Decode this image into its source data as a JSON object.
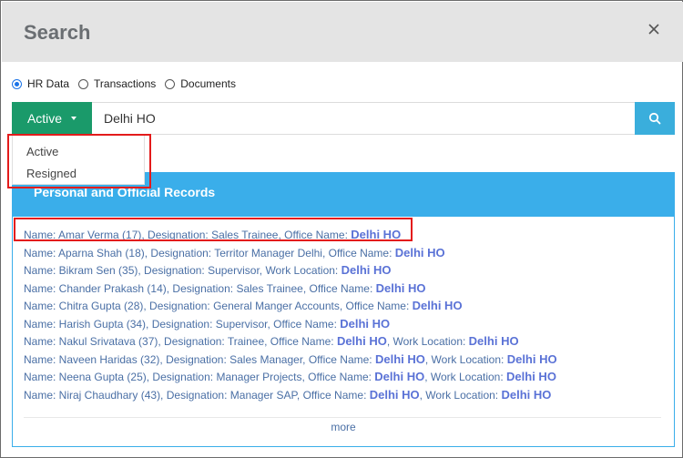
{
  "modal": {
    "title": "Search"
  },
  "search_type": {
    "options": [
      {
        "label": "HR Data",
        "checked": true
      },
      {
        "label": "Transactions",
        "checked": false
      },
      {
        "label": "Documents",
        "checked": false
      }
    ]
  },
  "search_bar": {
    "status_label": "Active",
    "query": "Delhi HO"
  },
  "status_dropdown": {
    "items": [
      "Active",
      "Resigned"
    ]
  },
  "panel": {
    "title": "Personal and Official Records",
    "more_label": "more"
  },
  "results": [
    {
      "prefix": "Name: Amar Verma (17), Designation: Sales Trainee, Office Name: ",
      "office": "Delhi HO",
      "mid": "",
      "work": ""
    },
    {
      "prefix": "Name: Aparna Shah (18), Designation: Territor Manager Delhi, Office Name: ",
      "office": "Delhi HO",
      "mid": "",
      "work": ""
    },
    {
      "prefix": "Name: Bikram Sen (35), Designation: Supervisor, Work Location: ",
      "office": "Delhi HO",
      "mid": "",
      "work": ""
    },
    {
      "prefix": "Name: Chander Prakash (14), Designation: Sales Trainee, Office Name: ",
      "office": "Delhi HO",
      "mid": "",
      "work": ""
    },
    {
      "prefix": "Name: Chitra Gupta (28), Designation: General Manger Accounts, Office Name: ",
      "office": "Delhi HO",
      "mid": "",
      "work": ""
    },
    {
      "prefix": "Name: Harish Gupta (34), Designation: Supervisor, Office Name: ",
      "office": "Delhi HO",
      "mid": "",
      "work": ""
    },
    {
      "prefix": "Name: Nakul Srivatava (37), Designation: Trainee, Office Name: ",
      "office": "Delhi HO",
      "mid": ", Work Location: ",
      "work": "Delhi HO"
    },
    {
      "prefix": "Name: Naveen Haridas (32), Designation: Sales Manager, Office Name: ",
      "office": "Delhi HO",
      "mid": ", Work Location: ",
      "work": "Delhi HO"
    },
    {
      "prefix": "Name: Neena Gupta (25), Designation: Manager Projects, Office Name: ",
      "office": "Delhi HO",
      "mid": ", Work Location: ",
      "work": "Delhi HO"
    },
    {
      "prefix": "Name: Niraj Chaudhary (43), Designation: Manager SAP, Office Name: ",
      "office": "Delhi HO",
      "mid": ", Work Location: ",
      "work": "Delhi HO"
    }
  ],
  "colors": {
    "status_button": "#1a9a6a",
    "search_button": "#3aaedc",
    "panel_header": "#3aaeea",
    "highlight": "#e31b1b",
    "link_text": "#4a6fa5"
  }
}
